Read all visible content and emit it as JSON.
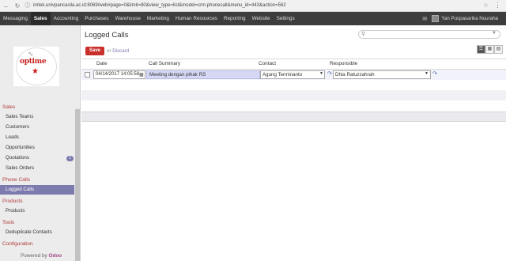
{
  "browser": {
    "url": "imtek.univpancasila.ac.id:8069/web#page=0&limit=80&view_type=list&model=crm.phonecall&menu_id=443&action=562"
  },
  "topnav": {
    "items": [
      "Messaging",
      "Sales",
      "Accounting",
      "Purchases",
      "Warehouse",
      "Marketing",
      "Human Resources",
      "Reporting",
      "Website",
      "Settings"
    ],
    "active": "Sales",
    "user_name": "Yan Puspasarika Nuuraha"
  },
  "sidebar": {
    "sections": {
      "sales": "Sales",
      "phone_calls": "Phone Calls",
      "products": "Products",
      "tools": "Tools",
      "configuration": "Configuration"
    },
    "links": {
      "sales_teams": "Sales Teams",
      "customers": "Customers",
      "leads": "Leads",
      "opportunities": "Opportunities",
      "quotations": "Quotations",
      "quotations_badge": "1",
      "sales_orders": "Sales Orders",
      "logged_calls": "Logged Calls",
      "products": "Products",
      "deduplicate": "Deduplicate Contacts",
      "cutoff": "Products"
    },
    "powered_prefix": "Powered by ",
    "powered_brand": "Odoo"
  },
  "main": {
    "title": "Logged Calls",
    "save_label": "Save",
    "discard_prefix": "or ",
    "discard_label": "Discard",
    "columns": {
      "date": "Date",
      "summary": "Call Summary",
      "contact": "Contact",
      "responsible": "Responsible"
    },
    "row": {
      "date": "04/14/2017 14:05:58",
      "summary": "Meeting dengan pihak RS",
      "contact": "Agung Terminanto",
      "responsible": "Dhia Ratuzzahrah"
    }
  },
  "colors": {
    "accent": "#7c7bad",
    "save": "#c9302c",
    "topbar": "#3d3d3d",
    "section": "#b03a3a"
  }
}
